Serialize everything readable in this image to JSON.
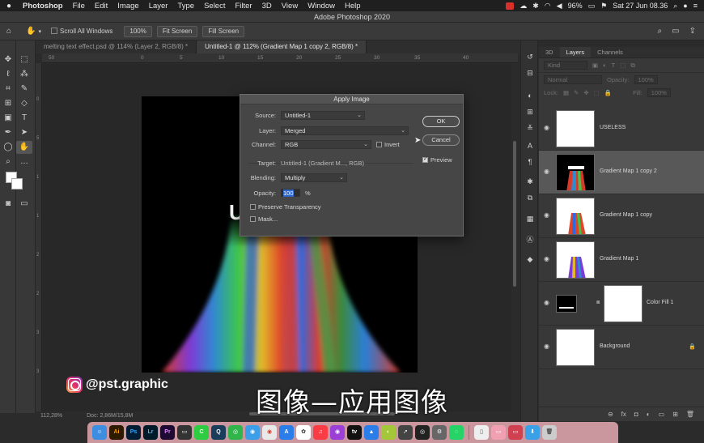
{
  "menubar": {
    "app": "Photoshop",
    "items": [
      "File",
      "Edit",
      "Image",
      "Layer",
      "Type",
      "Select",
      "Filter",
      "3D",
      "View",
      "Window",
      "Help"
    ],
    "battery": "96%",
    "clock": "Sat 27 Jun  08.36"
  },
  "window": {
    "title": "Adobe Photoshop 2020"
  },
  "options": {
    "scroll_all": "Scroll All Windows",
    "zoom": "100%",
    "fit_screen": "Fit Screen",
    "fill_screen": "Fill Screen"
  },
  "doc_tabs": [
    {
      "label": "melting text effect.psd @ 114% (Layer 2, RGB/8) *",
      "active": false
    },
    {
      "label": "Untitled-1 @ 112% (Gradient Map 1 copy 2, RGB/8) *",
      "active": true
    }
  ],
  "ruler_labels": {
    "h": [
      "50",
      "0",
      "5",
      "10",
      "15",
      "20",
      "25",
      "30",
      "35",
      "40"
    ],
    "v": [
      "0",
      "5",
      "1",
      "1",
      "2",
      "2",
      "3",
      "3",
      "4",
      "4"
    ]
  },
  "dialog": {
    "title": "Apply Image",
    "source_label": "Source:",
    "source_value": "Untitled-1",
    "layer_label": "Layer:",
    "layer_value": "Merged",
    "channel_label": "Channel:",
    "channel_value": "RGB",
    "invert_label": "Invert",
    "target_label": "Target:",
    "target_value": "Untitled-1 (Gradient M..., RGB)",
    "blending_label": "Blending:",
    "blending_value": "Multiply",
    "opacity_label": "Opacity:",
    "opacity_value": "100",
    "opacity_unit": "%",
    "preserve_label": "Preserve Transparency",
    "mask_label": "Mask...",
    "ok_label": "OK",
    "cancel_label": "Cancel",
    "preview_label": "Preview",
    "preview_checked": true
  },
  "layers_panel": {
    "tabs": [
      "3D",
      "Layers",
      "Channels"
    ],
    "active_tab": "Layers",
    "filter_kind": "Kind",
    "blend_mode": "Normal",
    "opacity_label": "Opacity:",
    "opacity_value": "100%",
    "lock_label": "Lock:",
    "fill_label": "Fill:",
    "fill_value": "100%",
    "layers": [
      {
        "name": "USELESS",
        "selected": false,
        "thumb": "checker"
      },
      {
        "name": "Gradient Map 1 copy 2",
        "selected": true,
        "thumb": "dark"
      },
      {
        "name": "Gradient Map 1 copy",
        "selected": false,
        "thumb": "rainbow"
      },
      {
        "name": "Gradient Map 1",
        "selected": false,
        "thumb": "rainbow"
      },
      {
        "name": "Color Fill 1",
        "selected": false,
        "thumb": "fill"
      },
      {
        "name": "Background",
        "selected": false,
        "thumb": "white",
        "locked": true
      }
    ]
  },
  "status": {
    "zoom": "112,28%",
    "doc": "Doc: 2,86M/15,8M"
  },
  "watermark": {
    "handle": "@pst.graphic"
  },
  "subtitle": "图像—应用图像",
  "colors": {
    "ui_dark": "#383838",
    "selection": "#585858",
    "accent_blue": "#2e65c8",
    "dock_bg": "#e6aab4"
  }
}
